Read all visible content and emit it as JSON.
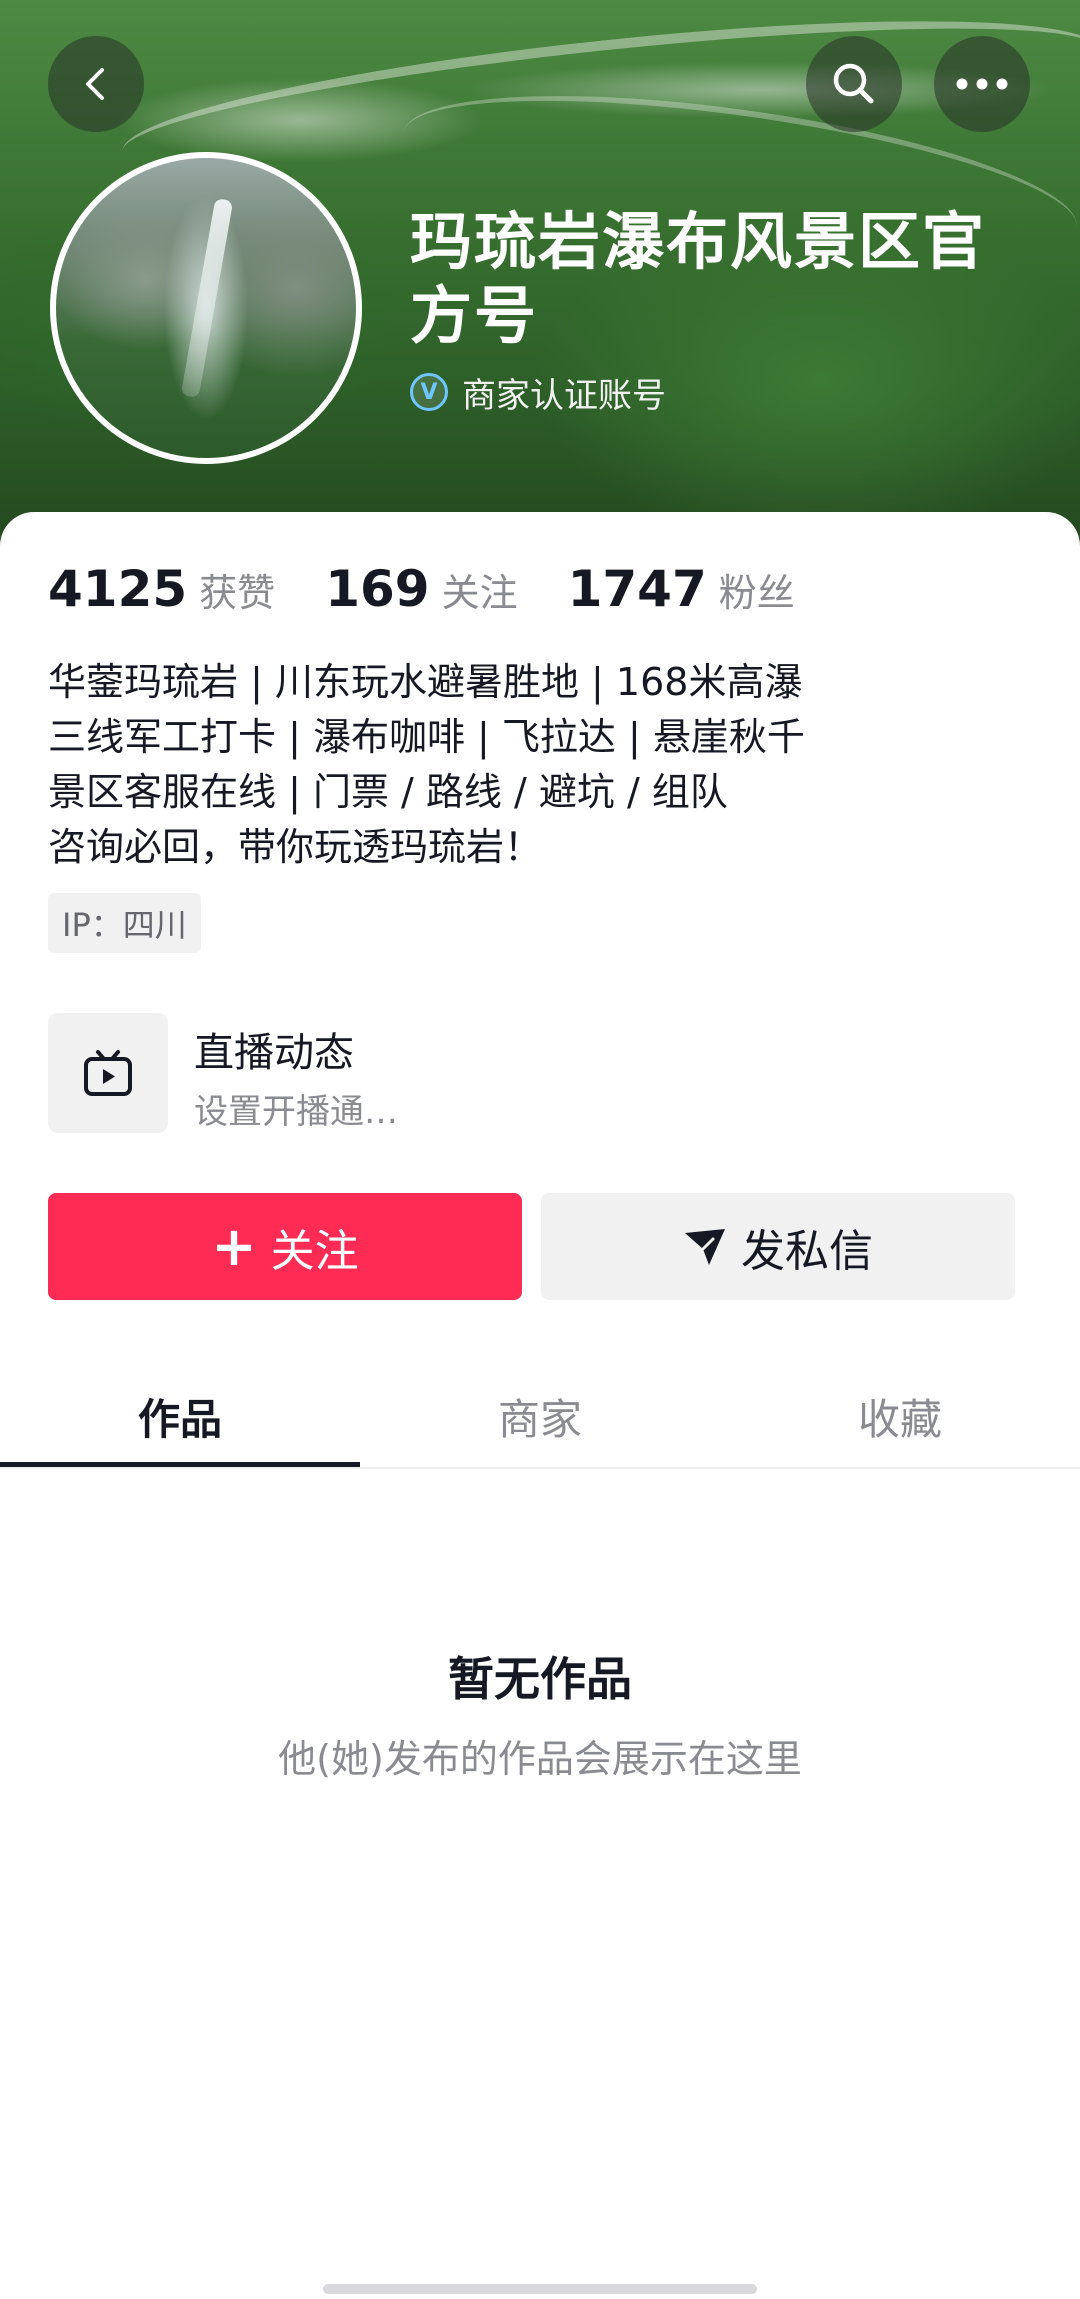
{
  "header": {
    "title": "玛琉岩瀑布风景区官方号",
    "verify_icon_glyph": "V",
    "verify_label": "商家认证账号"
  },
  "stats": [
    {
      "value": "4125",
      "label": "获赞"
    },
    {
      "value": "169",
      "label": "关注"
    },
    {
      "value": "1747",
      "label": "粉丝"
    }
  ],
  "bio": [
    "华蓥玛琉岩 | 川东玩水避暑胜地 | 168米高瀑",
    "三线军工打卡 | 瀑布咖啡 | 飞拉达 | 悬崖秋千",
    "景区客服在线 | 门票 / 路线 / 避坑 / 组队",
    "咨询必回，带你玩透玛琉岩！"
  ],
  "ip_tag": "IP：四川",
  "live": {
    "title": "直播动态",
    "subtitle": "设置开播通…"
  },
  "actions": {
    "follow_plus": "+",
    "follow_label": "关注",
    "message_label": "发私信"
  },
  "tabs": [
    {
      "label": "作品",
      "active": true
    },
    {
      "label": "商家",
      "active": false
    },
    {
      "label": "收藏",
      "active": false
    }
  ],
  "empty_state": {
    "title": "暂无作品",
    "subtitle": "他(她)发布的作品会展示在这里"
  },
  "icons": {
    "back": "back-arrow-icon",
    "search": "search-icon",
    "more": "more-icon",
    "verified": "verified-badge-icon",
    "live": "tv-icon",
    "message": "send-icon"
  },
  "colors": {
    "accent": "#fe2c55",
    "verified": "#6ec6ff",
    "text_primary": "#161823",
    "text_secondary": "#8a8b91"
  }
}
